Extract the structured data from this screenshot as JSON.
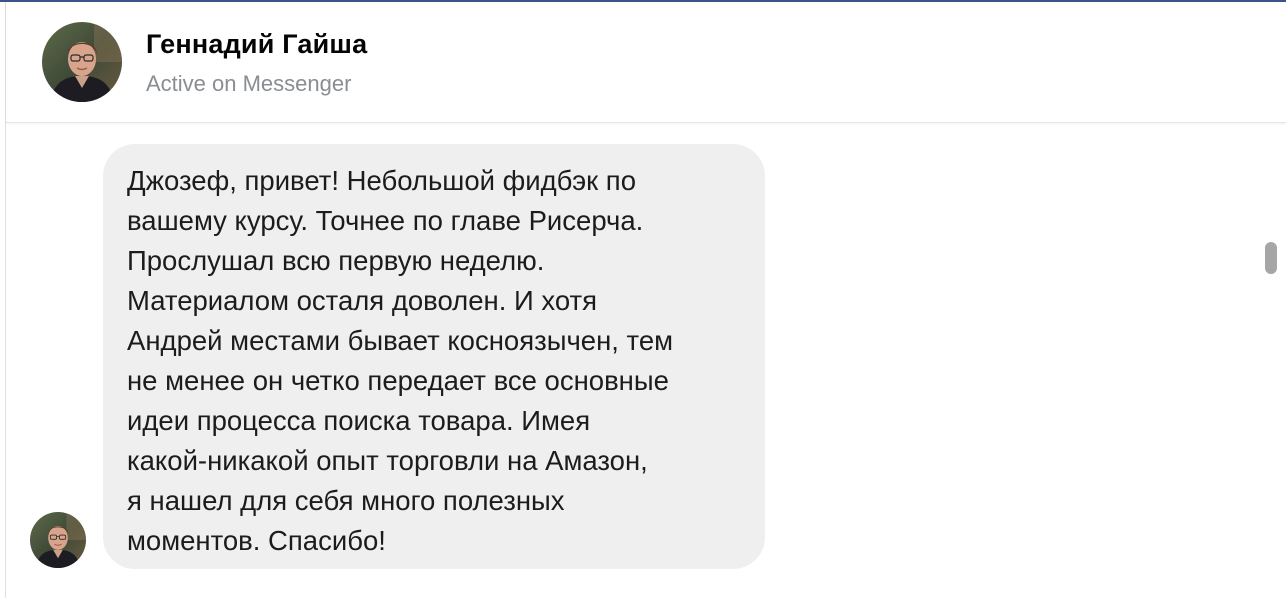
{
  "header": {
    "contact_name": "Геннадий Гайша",
    "status": "Active on Messenger"
  },
  "conversation": {
    "messages": [
      {
        "sender": "Геннадий Гайша",
        "text": "Джозеф, привет! Небольшой фидбэк по\nвашему курсу. Точнее по  главе Рисерча.\nПрослушал всю первую неделю.\nМатериалом осталя доволен. И хотя\nАндрей местами бывает косноязычен, тем\nне менее он четко передает все основные\nидеи процесса поиска товара. Имея\nкакой-никакой опыт торговли на Амазон,\nя нашел для себя много полезных\nмоментов. Спасибо!"
      }
    ]
  },
  "colors": {
    "accent_top_border": "#3b5488",
    "bubble_background": "#efefef",
    "status_text": "#8a8d91",
    "name_text": "#050505"
  },
  "icons": {
    "contact_avatar": "profile-photo",
    "message_avatar": "profile-photo"
  }
}
